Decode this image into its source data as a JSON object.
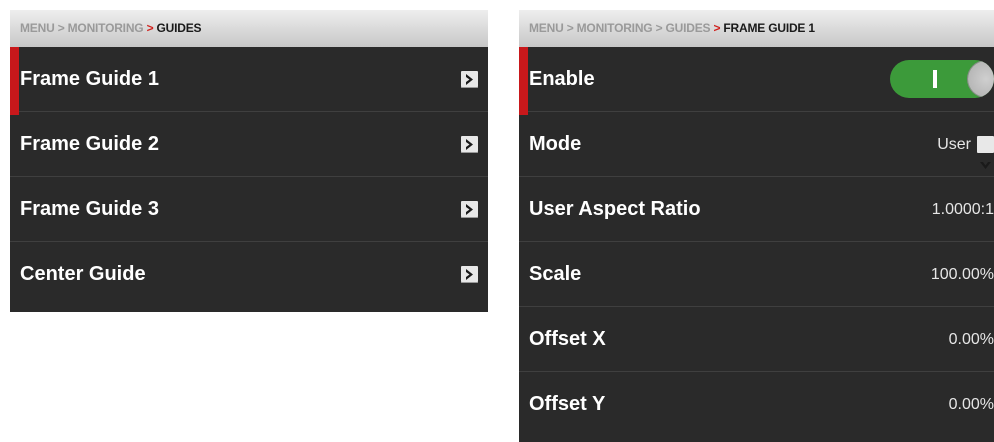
{
  "left": {
    "breadcrumb": {
      "part1": "MENU",
      "sep1": ">",
      "part2": "MONITORING",
      "sep2": ">",
      "current": "GUIDES"
    },
    "items": [
      {
        "label": "Frame Guide 1"
      },
      {
        "label": "Frame Guide 2"
      },
      {
        "label": "Frame Guide 3"
      },
      {
        "label": "Center Guide"
      }
    ],
    "selected_index": 0
  },
  "right": {
    "breadcrumb": {
      "part1": "MENU",
      "sep1": ">",
      "part2": "MONITORING",
      "sep2": ">",
      "part3": "GUIDES",
      "sep3": ">",
      "current": "FRAME GUIDE 1"
    },
    "enable": {
      "label": "Enable",
      "state": "on"
    },
    "mode": {
      "label": "Mode",
      "value": "User"
    },
    "aspect": {
      "label": "User Aspect Ratio",
      "value": "1.0000:1"
    },
    "scale": {
      "label": "Scale",
      "value": "100.00%"
    },
    "offset_x": {
      "label": "Offset X",
      "value": "0.00%"
    },
    "offset_y": {
      "label": "Offset Y",
      "value": "0.00%"
    }
  },
  "colors": {
    "panel": "#2a2a2a",
    "selection_bar": "#c8181b",
    "toggle_on": "#3c9a3a",
    "breadcrumb_accent": "#d0201c"
  },
  "icons": {
    "submenu": "chevron-right-icon",
    "dropdown": "chevron-down-icon"
  }
}
